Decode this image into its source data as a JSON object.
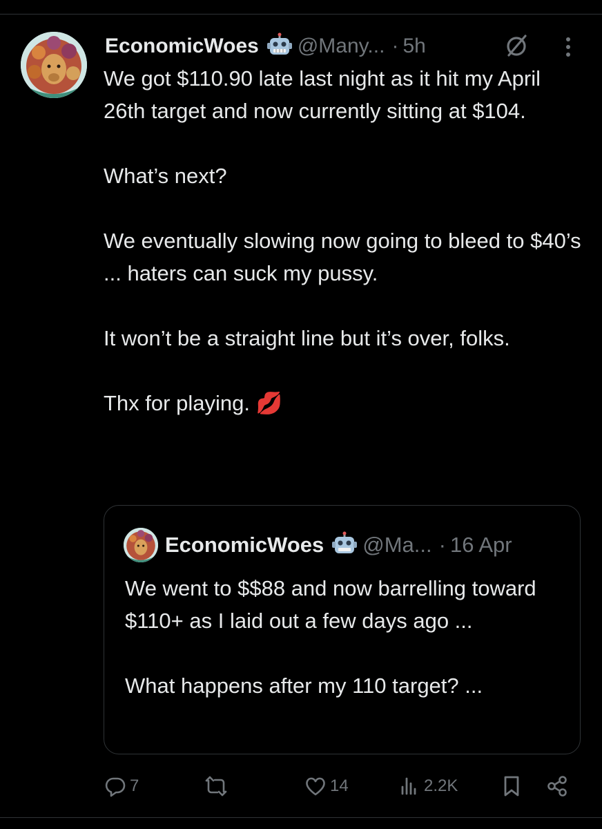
{
  "tweet": {
    "display_name": "EconomicWoes",
    "badge_icon": "robot-icon",
    "handle": "@Many...",
    "separator": "·",
    "time": "5h",
    "paragraphs": [
      "We got $110.90 late last night as it hit my April 26th target and now currently sitting at $104.",
      "What’s next?",
      "We eventually slowing now going to bleed to $40’s ... haters can suck my pussy.",
      "It won’t be a straight line but it’s over, folks.",
      "Thx for playing. 💋"
    ]
  },
  "quoted": {
    "display_name": "EconomicWoes",
    "badge_icon": "robot-icon",
    "handle": "@Ma...",
    "separator": "·",
    "time": "16 Apr",
    "paragraphs": [
      "We went to $$88 and now barrelling toward $110+ as I laid out a few days ago ...",
      "What happens after my 110 target? ..."
    ]
  },
  "actions": {
    "replies": "7",
    "reposts": "",
    "likes": "14",
    "views": "2.2K"
  },
  "colors": {
    "background": "#000000",
    "text": "#e7e9ea",
    "muted": "#71767b",
    "border": "#2f3336"
  }
}
